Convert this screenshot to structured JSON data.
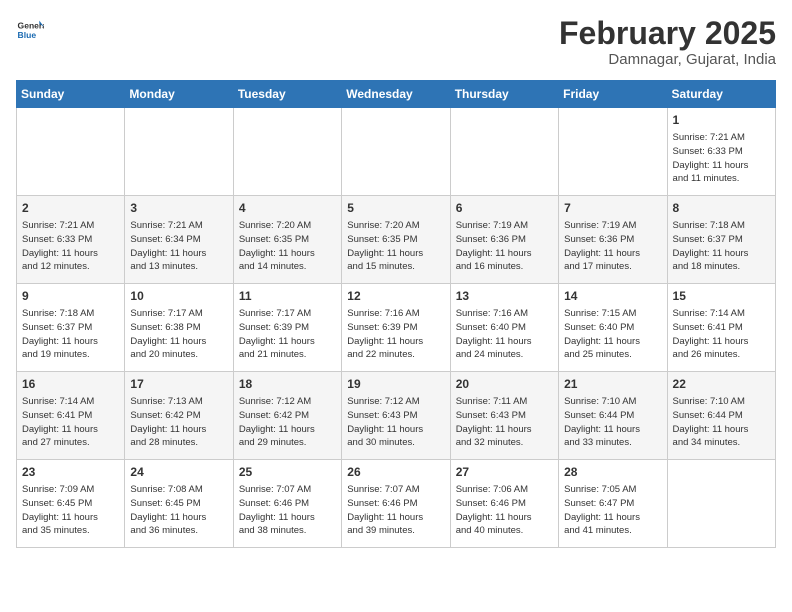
{
  "header": {
    "logo_general": "General",
    "logo_blue": "Blue",
    "month_title": "February 2025",
    "subtitle": "Damnagar, Gujarat, India"
  },
  "days_of_week": [
    "Sunday",
    "Monday",
    "Tuesday",
    "Wednesday",
    "Thursday",
    "Friday",
    "Saturday"
  ],
  "weeks": [
    [
      {
        "day": "",
        "info": ""
      },
      {
        "day": "",
        "info": ""
      },
      {
        "day": "",
        "info": ""
      },
      {
        "day": "",
        "info": ""
      },
      {
        "day": "",
        "info": ""
      },
      {
        "day": "",
        "info": ""
      },
      {
        "day": "1",
        "info": "Sunrise: 7:21 AM\nSunset: 6:33 PM\nDaylight: 11 hours\nand 11 minutes."
      }
    ],
    [
      {
        "day": "2",
        "info": "Sunrise: 7:21 AM\nSunset: 6:33 PM\nDaylight: 11 hours\nand 12 minutes."
      },
      {
        "day": "3",
        "info": "Sunrise: 7:21 AM\nSunset: 6:34 PM\nDaylight: 11 hours\nand 13 minutes."
      },
      {
        "day": "4",
        "info": "Sunrise: 7:20 AM\nSunset: 6:35 PM\nDaylight: 11 hours\nand 14 minutes."
      },
      {
        "day": "5",
        "info": "Sunrise: 7:20 AM\nSunset: 6:35 PM\nDaylight: 11 hours\nand 15 minutes."
      },
      {
        "day": "6",
        "info": "Sunrise: 7:19 AM\nSunset: 6:36 PM\nDaylight: 11 hours\nand 16 minutes."
      },
      {
        "day": "7",
        "info": "Sunrise: 7:19 AM\nSunset: 6:36 PM\nDaylight: 11 hours\nand 17 minutes."
      },
      {
        "day": "8",
        "info": "Sunrise: 7:18 AM\nSunset: 6:37 PM\nDaylight: 11 hours\nand 18 minutes."
      }
    ],
    [
      {
        "day": "9",
        "info": "Sunrise: 7:18 AM\nSunset: 6:37 PM\nDaylight: 11 hours\nand 19 minutes."
      },
      {
        "day": "10",
        "info": "Sunrise: 7:17 AM\nSunset: 6:38 PM\nDaylight: 11 hours\nand 20 minutes."
      },
      {
        "day": "11",
        "info": "Sunrise: 7:17 AM\nSunset: 6:39 PM\nDaylight: 11 hours\nand 21 minutes."
      },
      {
        "day": "12",
        "info": "Sunrise: 7:16 AM\nSunset: 6:39 PM\nDaylight: 11 hours\nand 22 minutes."
      },
      {
        "day": "13",
        "info": "Sunrise: 7:16 AM\nSunset: 6:40 PM\nDaylight: 11 hours\nand 24 minutes."
      },
      {
        "day": "14",
        "info": "Sunrise: 7:15 AM\nSunset: 6:40 PM\nDaylight: 11 hours\nand 25 minutes."
      },
      {
        "day": "15",
        "info": "Sunrise: 7:14 AM\nSunset: 6:41 PM\nDaylight: 11 hours\nand 26 minutes."
      }
    ],
    [
      {
        "day": "16",
        "info": "Sunrise: 7:14 AM\nSunset: 6:41 PM\nDaylight: 11 hours\nand 27 minutes."
      },
      {
        "day": "17",
        "info": "Sunrise: 7:13 AM\nSunset: 6:42 PM\nDaylight: 11 hours\nand 28 minutes."
      },
      {
        "day": "18",
        "info": "Sunrise: 7:12 AM\nSunset: 6:42 PM\nDaylight: 11 hours\nand 29 minutes."
      },
      {
        "day": "19",
        "info": "Sunrise: 7:12 AM\nSunset: 6:43 PM\nDaylight: 11 hours\nand 30 minutes."
      },
      {
        "day": "20",
        "info": "Sunrise: 7:11 AM\nSunset: 6:43 PM\nDaylight: 11 hours\nand 32 minutes."
      },
      {
        "day": "21",
        "info": "Sunrise: 7:10 AM\nSunset: 6:44 PM\nDaylight: 11 hours\nand 33 minutes."
      },
      {
        "day": "22",
        "info": "Sunrise: 7:10 AM\nSunset: 6:44 PM\nDaylight: 11 hours\nand 34 minutes."
      }
    ],
    [
      {
        "day": "23",
        "info": "Sunrise: 7:09 AM\nSunset: 6:45 PM\nDaylight: 11 hours\nand 35 minutes."
      },
      {
        "day": "24",
        "info": "Sunrise: 7:08 AM\nSunset: 6:45 PM\nDaylight: 11 hours\nand 36 minutes."
      },
      {
        "day": "25",
        "info": "Sunrise: 7:07 AM\nSunset: 6:46 PM\nDaylight: 11 hours\nand 38 minutes."
      },
      {
        "day": "26",
        "info": "Sunrise: 7:07 AM\nSunset: 6:46 PM\nDaylight: 11 hours\nand 39 minutes."
      },
      {
        "day": "27",
        "info": "Sunrise: 7:06 AM\nSunset: 6:46 PM\nDaylight: 11 hours\nand 40 minutes."
      },
      {
        "day": "28",
        "info": "Sunrise: 7:05 AM\nSunset: 6:47 PM\nDaylight: 11 hours\nand 41 minutes."
      },
      {
        "day": "",
        "info": ""
      }
    ]
  ]
}
